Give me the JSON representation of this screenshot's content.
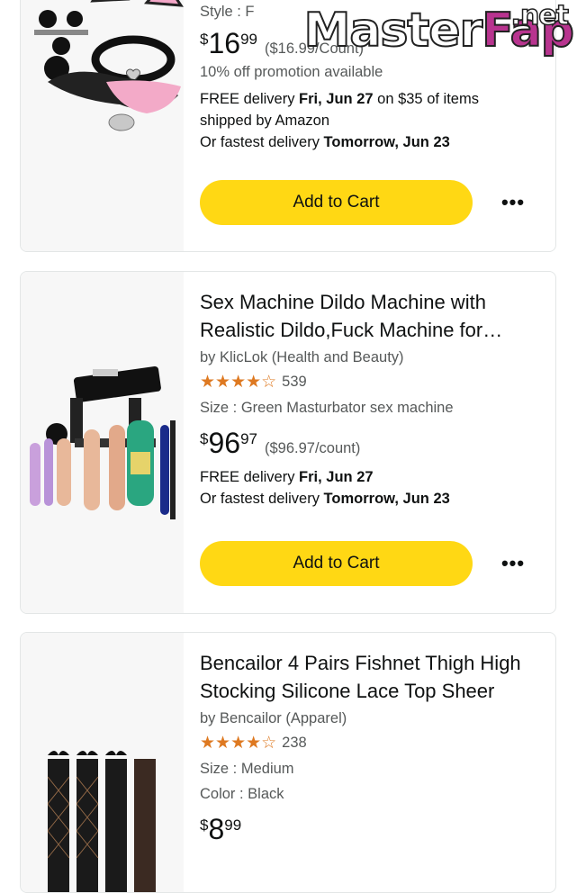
{
  "watermark": {
    "part1": "Master",
    "part2": "Fap",
    "tld": ".net"
  },
  "products": [
    {
      "style": "Style : F",
      "price": {
        "currency": "$",
        "whole": "16",
        "fraction": "99",
        "unit": "($16.99/Count)"
      },
      "promo": "10% off promotion available",
      "delivery_line1_pre": "FREE delivery ",
      "delivery_line1_bold": "Fri, Jun 27",
      "delivery_line1_post": " on $35 of items",
      "delivery_line2": "shipped by Amazon",
      "fastest_pre": "Or fastest delivery ",
      "fastest_bold": "Tomorrow, Jun 23",
      "button": "Add to Cart",
      "more": "•••"
    },
    {
      "title": "Sex Machine Dildo Machine with Realistic Dildo,Fuck Machine for Women",
      "byline": "by KlicLok (Health and Beauty)",
      "stars": "★★★★☆",
      "rating_count": "539",
      "size": "Size : Green Masturbator sex machine",
      "price": {
        "currency": "$",
        "whole": "96",
        "fraction": "97",
        "unit": "($96.97/count)"
      },
      "delivery_pre": "FREE delivery ",
      "delivery_bold": "Fri, Jun 27",
      "fastest_pre": "Or fastest delivery ",
      "fastest_bold": "Tomorrow, Jun 23",
      "button": "Add to Cart",
      "more": "•••"
    },
    {
      "title": "Bencailor 4 Pairs Fishnet Thigh High Stocking Silicone Lace Top Sheer",
      "byline": "by Bencailor (Apparel)",
      "stars": "★★★★☆",
      "rating_count": "238",
      "size": "Size : Medium",
      "color": "Color : Black",
      "price": {
        "currency": "$",
        "whole": "8",
        "fraction": "99"
      }
    }
  ],
  "colors": {
    "button": "#ffd814",
    "star": "#de7921",
    "border": "#e3e6e6",
    "muted": "#565959"
  }
}
